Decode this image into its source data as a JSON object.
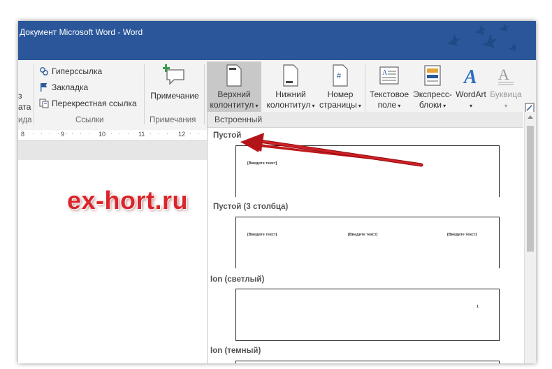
{
  "window": {
    "title": "Документ Microsoft Word - Word"
  },
  "ribbon": {
    "partial_left": {
      "line1": "з",
      "line2": "ата",
      "group_label": "ида"
    },
    "links_group": {
      "hyperlink": "Гиперссылка",
      "bookmark": "Закладка",
      "cross_reference": "Перекрестная ссылка",
      "label": "Ссылки"
    },
    "comments_group": {
      "comment": "Примечание",
      "label": "Примечания"
    },
    "header_footer": {
      "header_line1": "Верхний",
      "header_line2": "колонтитул",
      "footer_line1": "Нижний",
      "footer_line2": "колонтитул",
      "page_number_line1": "Номер",
      "page_number_line2": "страницы"
    },
    "text_group": {
      "text_box_line1": "Текстовое",
      "text_box_line2": "поле",
      "quick_parts_line1": "Экспресс-",
      "quick_parts_line2": "блоки",
      "wordart": "WordArt",
      "drop_cap": "Буквица"
    }
  },
  "ruler": {
    "marks": [
      "8",
      "9",
      "10",
      "11",
      "12"
    ]
  },
  "watermark": "ex-hort.ru",
  "gallery": {
    "section_header": "Встроенный",
    "items": [
      {
        "label": "Пустой",
        "placeholders": [
          "[Введите текст]"
        ]
      },
      {
        "label": "Пустой (3 столбца)",
        "placeholders": [
          "[Введите текст]",
          "[Введите текст]",
          "[Введите текст]"
        ]
      },
      {
        "label": "Ion (светлый)",
        "placeholders": [
          "1"
        ]
      },
      {
        "label": "Ion (темный)",
        "placeholders": []
      }
    ]
  },
  "colors": {
    "titlebar": "#2b579a",
    "ribbon_bg": "#f3f3f3",
    "arrow": "#c0161c",
    "watermark": "#d9262b",
    "active_button": "#c8c8c8"
  }
}
